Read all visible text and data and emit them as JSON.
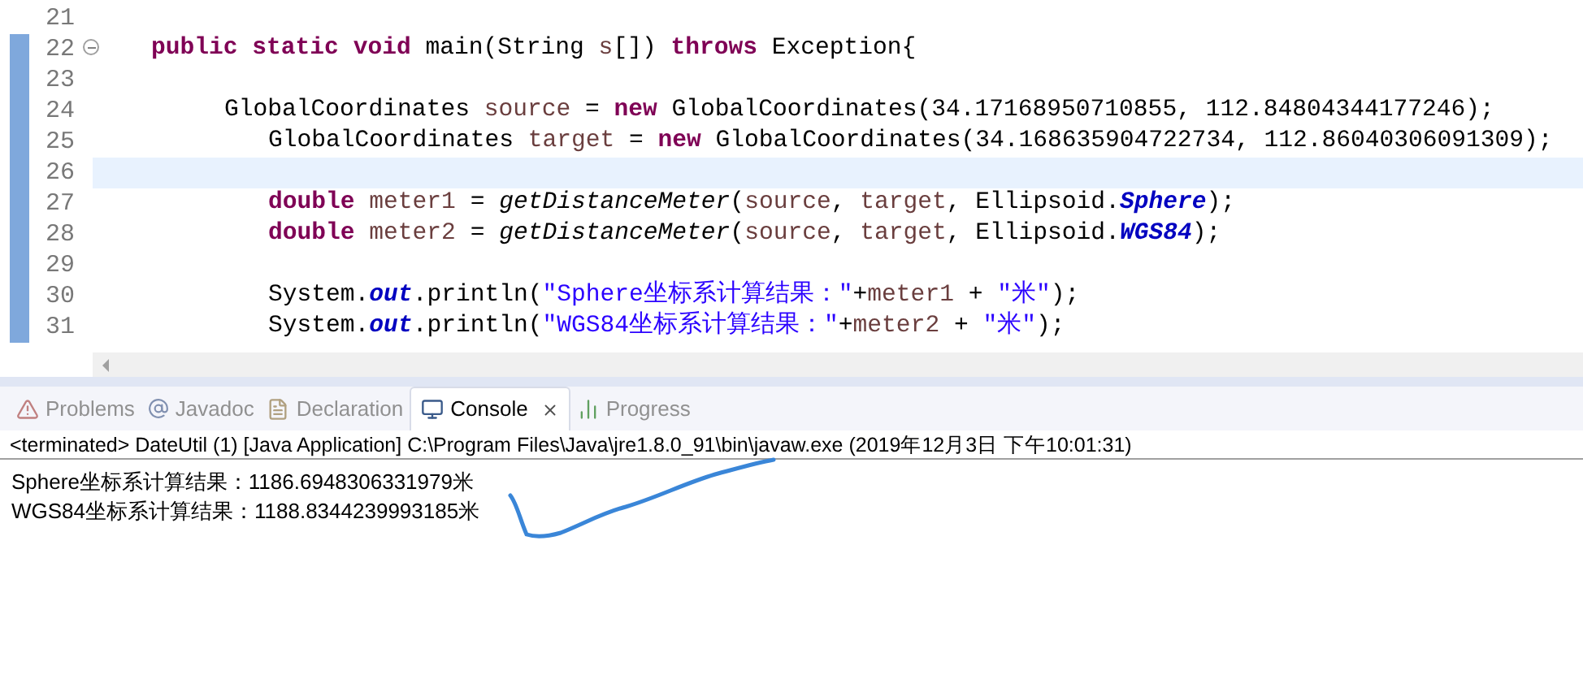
{
  "editor": {
    "lines": [
      {
        "number": "21"
      },
      {
        "number": "22",
        "fold": true,
        "kind": "member",
        "tokens": [
          {
            "kind": "keyword",
            "text": "public"
          },
          {
            "kind": "keyword",
            "text": " static"
          },
          {
            "kind": "keyword",
            "text": " void"
          },
          {
            "kind": "plain",
            "text": " main(String "
          },
          {
            "kind": "variable",
            "text": "s"
          },
          {
            "kind": "plain",
            "text": "[]) "
          },
          {
            "kind": "keyword",
            "text": "throws"
          },
          {
            "kind": "plain",
            "text": " Exception{"
          }
        ]
      },
      {
        "number": "23"
      },
      {
        "number": "24",
        "kind": "block",
        "tokens": [
          {
            "kind": "plain",
            "text": "GlobalCoordinates "
          },
          {
            "kind": "variable",
            "text": "source"
          },
          {
            "kind": "plain",
            "text": " = "
          },
          {
            "kind": "keyword",
            "text": "new"
          },
          {
            "kind": "plain",
            "text": " GlobalCoordinates(34.17168950710855, 112.84804344177246);"
          }
        ]
      },
      {
        "number": "25",
        "kind": "nested",
        "tokens": [
          {
            "kind": "plain",
            "text": "GlobalCoordinates "
          },
          {
            "kind": "variable",
            "text": "target"
          },
          {
            "kind": "plain",
            "text": " = "
          },
          {
            "kind": "keyword",
            "text": "new"
          },
          {
            "kind": "plain",
            "text": " GlobalCoordinates(34.168635904722734, 112.86040306091309);"
          }
        ]
      },
      {
        "number": "26",
        "current": true
      },
      {
        "number": "27",
        "kind": "nested",
        "tokens": [
          {
            "kind": "keyword",
            "text": "double"
          },
          {
            "kind": "variable",
            "text": " meter1"
          },
          {
            "kind": "plain",
            "text": " = "
          },
          {
            "kind": "method",
            "text": "getDistanceMeter"
          },
          {
            "kind": "plain",
            "text": "("
          },
          {
            "kind": "variable",
            "text": "source"
          },
          {
            "kind": "plain",
            "text": ", "
          },
          {
            "kind": "variable",
            "text": "target"
          },
          {
            "kind": "plain",
            "text": ", Ellipsoid."
          },
          {
            "kind": "static",
            "text": "Sphere"
          },
          {
            "kind": "plain",
            "text": ");"
          }
        ]
      },
      {
        "number": "28",
        "kind": "nested",
        "tokens": [
          {
            "kind": "keyword",
            "text": "double"
          },
          {
            "kind": "variable",
            "text": " meter2"
          },
          {
            "kind": "plain",
            "text": " = "
          },
          {
            "kind": "method",
            "text": "getDistanceMeter"
          },
          {
            "kind": "plain",
            "text": "("
          },
          {
            "kind": "variable",
            "text": "source"
          },
          {
            "kind": "plain",
            "text": ", "
          },
          {
            "kind": "variable",
            "text": "target"
          },
          {
            "kind": "plain",
            "text": ", Ellipsoid."
          },
          {
            "kind": "static",
            "text": "WGS84"
          },
          {
            "kind": "plain",
            "text": ");"
          }
        ]
      },
      {
        "number": "29"
      },
      {
        "number": "30",
        "kind": "nested",
        "tokens": [
          {
            "kind": "plain",
            "text": "System."
          },
          {
            "kind": "static",
            "text": "out"
          },
          {
            "kind": "plain",
            "text": ".println("
          },
          {
            "kind": "string",
            "text": "\"Sphere坐标系计算结果：\""
          },
          {
            "kind": "plain",
            "text": "+"
          },
          {
            "kind": "variable",
            "text": "meter1"
          },
          {
            "kind": "plain",
            "text": " + "
          },
          {
            "kind": "string",
            "text": "\"米\""
          },
          {
            "kind": "plain",
            "text": ");"
          }
        ]
      },
      {
        "number": "31",
        "kind": "nested",
        "tokens": [
          {
            "kind": "plain",
            "text": "System."
          },
          {
            "kind": "static",
            "text": "out"
          },
          {
            "kind": "plain",
            "text": ".println("
          },
          {
            "kind": "string",
            "text": "\"WGS84坐标系计算结果：\""
          },
          {
            "kind": "plain",
            "text": "+"
          },
          {
            "kind": "variable",
            "text": "meter2"
          },
          {
            "kind": "plain",
            "text": " + "
          },
          {
            "kind": "string",
            "text": "\"米\""
          },
          {
            "kind": "plain",
            "text": ");"
          }
        ]
      }
    ]
  },
  "tabs": [
    {
      "label": "Problems",
      "selected": false
    },
    {
      "label": "Javadoc",
      "selected": false
    },
    {
      "label": "Declaration",
      "selected": false
    },
    {
      "label": "Console",
      "selected": true
    },
    {
      "label": "Progress",
      "selected": false
    }
  ],
  "console": {
    "status": "<terminated> DateUtil (1) [Java Application] C:\\Program Files\\Java\\jre1.8.0_91\\bin\\javaw.exe (2019年12月3日 下午10:01:31)",
    "output": [
      "Sphere坐标系计算结果：1186.6948306331979米",
      "WGS84坐标系计算结果：1188.8344239993185米"
    ]
  }
}
